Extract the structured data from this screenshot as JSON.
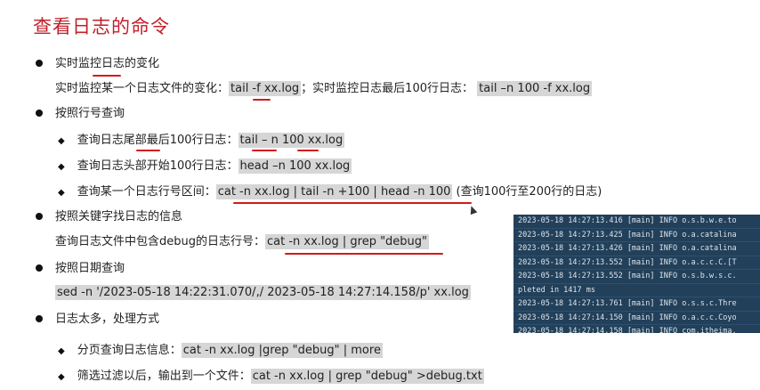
{
  "title": "查看日志的命令",
  "sections": {
    "realtime": {
      "heading": "实时监控日志的变化",
      "desc_prefix": "实时监控某一个日志文件的变化：",
      "cmd1": "tail -f xx.log",
      "desc_mid": "；实时监控日志最后100行日志：",
      "cmd2": "tail –n 100 -f xx.log"
    },
    "by_line": {
      "heading": "按照行号查询",
      "item1_label": "查询日志尾部最后100行日志：",
      "item1_cmd": "tail – n 100 xx.log",
      "item2_label": "查询日志头部开始100行日志：",
      "item2_cmd": "head –n 100 xx.log",
      "item3_label": "查询某一个日志行号区间：",
      "item3_cmd": "cat -n xx.log | tail -n +100 | head -n 100",
      "item3_note": "(查询100行至200行的日志)"
    },
    "keyword": {
      "heading": "按照关键字找日志的信息",
      "desc": "查询日志文件中包含debug的日志行号：",
      "cmd": "cat -n xx.log | grep \"debug\""
    },
    "by_date": {
      "heading": "按照日期查询",
      "cmd": "sed -n '/2023-05-18 14:22:31.070/,/ 2023-05-18 14:27:14.158/p'   xx.log"
    },
    "too_many": {
      "heading": "日志太多，处理方式",
      "item1_label": "分页查询日志信息：",
      "item1_cmd": "cat -n xx.log |grep \"debug\" | more",
      "item2_label": "筛选过滤以后，输出到一个文件：",
      "item2_cmd": "cat -n xx.log | grep \"debug\" >debug.txt"
    }
  },
  "terminal_lines": [
    "2023-05-18 14:27:13.416 [main] INFO  o.s.b.w.e.to",
    "2023-05-18 14:27:13.425 [main] INFO  o.a.catalina",
    "2023-05-18 14:27:13.426 [main] INFO  o.a.catalina",
    "2023-05-18 14:27:13.552 [main] INFO  o.a.c.c.C.[T",
    "2023-05-18 14:27:13.552 [main] INFO  o.s.b.w.s.c.",
    "pleted in 1417 ms",
    "2023-05-18 14:27:13.761 [main] INFO  o.s.s.c.Thre",
    "2023-05-18 14:27:14.150 [main] INFO  o.a.c.c.Coyo",
    "2023-05-18 14:27:14.158 [main] INFO  com.itheima."
  ]
}
